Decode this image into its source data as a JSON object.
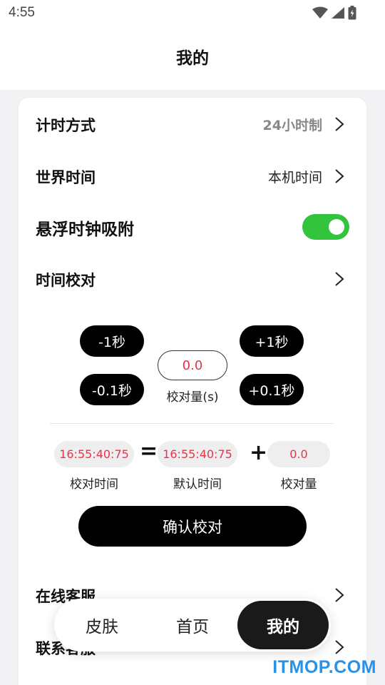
{
  "status_bar": {
    "time": "4:55",
    "icons": [
      "wifi-icon",
      "cell-signal-icon",
      "battery-charging-icon"
    ]
  },
  "header": {
    "title": "我的"
  },
  "settings": {
    "timing_mode": {
      "label": "计时方式",
      "value": "24小时制"
    },
    "world_time": {
      "label": "世界时间",
      "value": "本机时间"
    },
    "floating_clock": {
      "label": "悬浮时钟吸附",
      "enabled": true
    },
    "time_calibration": {
      "label": "时间校对"
    }
  },
  "calibration": {
    "minus_1s": "-1秒",
    "minus_0_1s": "-0.1秒",
    "plus_1s": "+1秒",
    "plus_0_1s": "+0.1秒",
    "offset_value": "0.0",
    "offset_label": "校对量(s)",
    "result_time": "16:55:40:75",
    "result_caption": "校对时间",
    "equals_sign": "=",
    "default_time": "16:55:40:75",
    "default_caption": "默认时间",
    "plus_sign": "+",
    "amount_value": "0.0",
    "amount_caption": "校对量",
    "confirm_label": "确认校对"
  },
  "more_items": {
    "online_service": "在线客服",
    "contact_service": "联系客服"
  },
  "tabs": {
    "skin": "皮肤",
    "home": "首页",
    "mine": "我的",
    "active": "mine"
  },
  "watermark": "ITMOP.COM",
  "colors": {
    "accent_red": "#e8334a",
    "toggle_green": "#33c43d",
    "watermark_blue": "#2a91e6"
  }
}
